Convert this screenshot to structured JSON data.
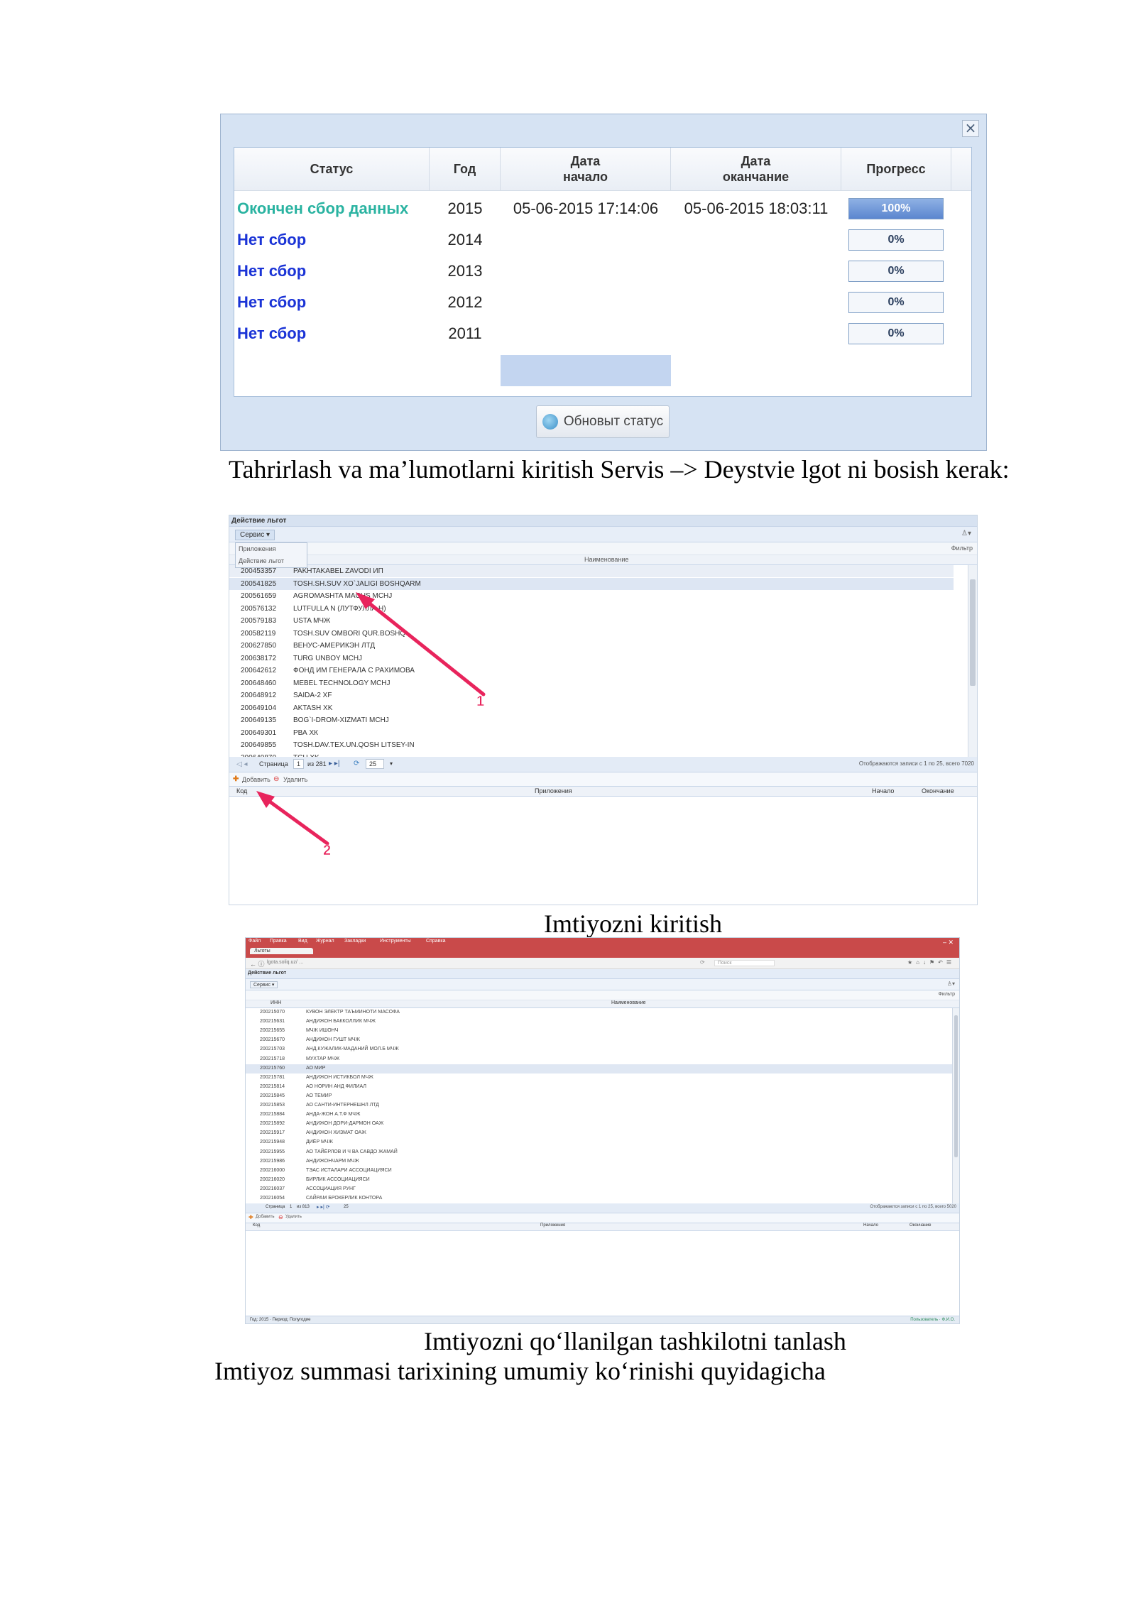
{
  "status_dialog": {
    "close_label": "×",
    "headers": {
      "status": "Статус",
      "year": "Год",
      "start_line1": "Дата",
      "start_line2": "начало",
      "end_line1": "Дата",
      "end_line2": "оканчание",
      "progress": "Прогресс"
    },
    "rows": [
      {
        "status": "Окончен сбор данных",
        "year": "2015",
        "start": "05-06-2015 17:14:06",
        "end": "05-06-2015 18:03:11",
        "progress": "100%",
        "progress_value": 100
      },
      {
        "status": "Нет сбор",
        "year": "2014",
        "start": "",
        "end": "",
        "progress": "0%",
        "progress_value": 0
      },
      {
        "status": "Нет сбор",
        "year": "2013",
        "start": "",
        "end": "",
        "progress": "0%",
        "progress_value": 0
      },
      {
        "status": "Нет сбор",
        "year": "2012",
        "start": "",
        "end": "",
        "progress": "0%",
        "progress_value": 0
      },
      {
        "status": "Нет сбор",
        "year": "2011",
        "start": "",
        "end": "",
        "progress": "0%",
        "progress_value": 0
      }
    ],
    "refresh_button": "Обновыт статус"
  },
  "captions": {
    "c1": "Tahrirlash va ma’lumotlarni kiritish Servis –> Deystvie lgot ni bosish kerak:",
    "c2": "Imtiyozni kiritish",
    "c3": "Imtiyozni qo‘llanilgan tashkilotni tanlash",
    "c4": "Imtiyoz summasi tarixining umumiy ko‘rinishi quyidagicha"
  },
  "shot2": {
    "window_title": "Действие льгот",
    "menu_button": "Сервис ▾",
    "menu_items": [
      "Приложения",
      "Действие льгот"
    ],
    "filter_label": "Фильтр",
    "column_name": "Наименование",
    "rows": [
      {
        "code": "200453357",
        "name": "PAKHTAKABEL ZAVODI ИП"
      },
      {
        "code": "200541825",
        "name": "TOSH.SH.SUV XO`JALIGI BOSHQARM"
      },
      {
        "code": "200561659",
        "name": "AGROMASHTA MACHS MCHJ"
      },
      {
        "code": "200576132",
        "name": "LUTFULLA N (ЛУТФУЛЛА Н)"
      },
      {
        "code": "200579183",
        "name": "USTA МЧЖ"
      },
      {
        "code": "200582119",
        "name": "TOSH.SUV OMBORI QUR.BOSHQ"
      },
      {
        "code": "200627850",
        "name": "ВЕНУС-АМЕРИКЭН ЛТД"
      },
      {
        "code": "200638172",
        "name": "TURG UNBOY MCHJ"
      },
      {
        "code": "200642612",
        "name": "ФОНД ИМ ГЕНЕРАЛА С РАХИМОВА"
      },
      {
        "code": "200648460",
        "name": "MEBEL TECHNOLOGY MCHJ"
      },
      {
        "code": "200648912",
        "name": "SAIDA-2 XF"
      },
      {
        "code": "200649104",
        "name": "AKTASH XK"
      },
      {
        "code": "200649135",
        "name": "BOG`I-DROM-XIZMATI MCHJ"
      },
      {
        "code": "200649301",
        "name": "РВА ХК"
      },
      {
        "code": "200649855",
        "name": "TOSH.DAV.TEX.UN.QOSH LITSEY-IN"
      },
      {
        "code": "200649870",
        "name": "TCH XK"
      }
    ],
    "pager_page": "Страница",
    "pager_current": "1",
    "pager_of": "из 281",
    "pager_size": "25",
    "pager_info": "Отображаются записи с 1 по 25, всего 7020",
    "add_button": "Добавить",
    "delete_button": "Удалить",
    "bottom_headers": {
      "code": "Код",
      "app": "Приложения",
      "start": "Начало",
      "end": "Окончание"
    },
    "arrow1": "1",
    "arrow2": "2"
  },
  "shot3": {
    "browser_menu": [
      "Файл",
      "Правка",
      "Вид",
      "Журнал",
      "Закладки",
      "Инструменты",
      "Справка"
    ],
    "tab_title": "Льготы",
    "url": "lgota.soliq.uz/ …",
    "search_placeholder": "Поиск",
    "window_title": "Действие льгот",
    "menu_button": "Сервис ▾",
    "filter_label": "Фильтр",
    "col_inn": "ИНН",
    "col_name": "Наименование",
    "rows": [
      {
        "code": "200215070",
        "name": "КУВОН ЭЛЕКТР ТАЪМИНОТИ МАСОФА"
      },
      {
        "code": "200215631",
        "name": "АНДИЖОН БАККОЛЛИК МЧЖ"
      },
      {
        "code": "200215655",
        "name": "МЧЖ ИШОНЧ"
      },
      {
        "code": "200215670",
        "name": "АНДИЖОН ГУШТ МЧЖ"
      },
      {
        "code": "200215703",
        "name": "АНД.КУЖАЛИК-МАДАНИЙ МОЛ.Б МЧЖ"
      },
      {
        "code": "200215718",
        "name": "МУХТАР МЧЖ"
      },
      {
        "code": "200215760",
        "name": "АО МИР"
      },
      {
        "code": "200215781",
        "name": "АНДИЖОН ИСТИКБОЛ МЧЖ"
      },
      {
        "code": "200215814",
        "name": "АО НОРИН АНД ФИЛИАЛ"
      },
      {
        "code": "200215845",
        "name": "АО ТЕМИР"
      },
      {
        "code": "200215853",
        "name": "АО САНТИ-ИНТЕРНЕШНЛ ЛТД"
      },
      {
        "code": "200215884",
        "name": "АНДА-ЖОН А.Т.Ф МЧЖ"
      },
      {
        "code": "200215892",
        "name": "АНДИЖОН ДОРИ-ДАРМОН ОАЖ"
      },
      {
        "code": "200215917",
        "name": "АНДИЖОН ХИЗМАТ ОАЖ"
      },
      {
        "code": "200215948",
        "name": "ДИЁР МЧЖ"
      },
      {
        "code": "200215955",
        "name": "АО ТАЙЁРЛОВ И Ч ВА САВДО ЖАМАЙ"
      },
      {
        "code": "200215986",
        "name": "АНДИЖОНЧАРМ МЧЖ"
      },
      {
        "code": "200216000",
        "name": "ТЭАС ИСТАЛАРИ АССОЦИАЦИЯСИ"
      },
      {
        "code": "200216020",
        "name": "БИРЛИК АССОЦИАЦИЯСИ"
      },
      {
        "code": "200216037",
        "name": "АССОЦИАЦИЯ РУНГ"
      },
      {
        "code": "200216054",
        "name": "САЙРАМ БРОКЕРЛИК КОНТОРА"
      }
    ],
    "pager_page": "Страница",
    "pager_current": "1",
    "pager_of": "из 813",
    "pager_size": "25",
    "pager_info": "Отображаются записи с 1 по 25, всего 5020",
    "add_button": "Добавить",
    "delete_button": "Удалить",
    "bottom_headers": {
      "code": "Код",
      "app": "Приложения",
      "start": "Начало",
      "end": "Окончание"
    },
    "status_left": "Год: 2015 · Период: Полугодие",
    "status_right": "Пользователь · Ф.И.О."
  },
  "colors": {
    "status_done": "#2ab3a1",
    "status_none": "#1a33d6",
    "arrow": "#e8245c",
    "browser_bar": "#c94a4a"
  }
}
